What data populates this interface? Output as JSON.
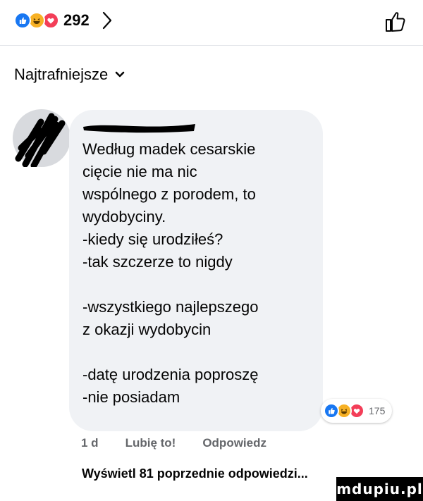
{
  "header": {
    "reaction_count": "292",
    "icons": [
      "like-reaction-icon",
      "haha-reaction-icon",
      "love-reaction-icon",
      "chevron-right-icon",
      "like-outline-icon"
    ],
    "colors": {
      "like": "#1877f2",
      "haha": "#f7b125",
      "love": "#f33e58"
    }
  },
  "sort": {
    "label": "Najtrafniejsze"
  },
  "comment": {
    "lines": [
      "Według madek cesarskie",
      "cięcie nie ma nic",
      "wspólnego z porodem, to",
      "wydobyciny.",
      "-kiedy się urodziłeś?",
      "-tak szczerze to nigdy",
      "",
      "-wszystkiego najlepszego",
      "z okazji wydobycin",
      "",
      "-datę urodzenia poproszę",
      "-nie posiadam"
    ],
    "reaction_count": "175",
    "bubble_color": "#f0f2f5"
  },
  "actions": {
    "time": "1 d",
    "like": "Lubię to!",
    "reply": "Odpowiedz"
  },
  "previous": {
    "label": "Wyświetl 81 poprzednie odpowiedzi..."
  },
  "watermark": {
    "text": "mdupiu.pl"
  }
}
